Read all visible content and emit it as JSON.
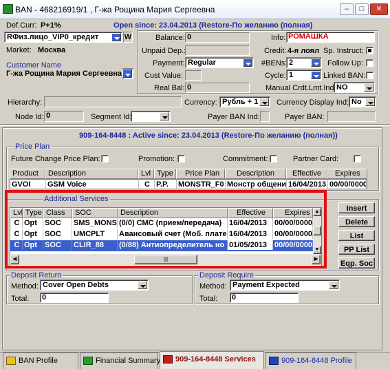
{
  "window": {
    "title": "BAN - 468216919/1 , Г-жа Рощина Мария Сергеевна",
    "min": "–",
    "max": "□",
    "close": "✕"
  },
  "header": {
    "def_curr_label": "Def.Curr:",
    "def_curr_value": "Р+1%",
    "open_since": "Open since: 23.04.2013 (Restore-По желанию (полная)",
    "account_type": "RФиз.лицо_VIP0_кредит",
    "account_type_flag": "W",
    "market_label": "Market:",
    "market_value": "Москва",
    "customer_name_label": "Customer Name",
    "customer_name_value": "Г-жа Рощина Мария Сергеевна",
    "balance_label": "Balance:",
    "balance_value": "0",
    "unpaid_dep_label": "Unpaid Dep.:",
    "unpaid_dep_value": "",
    "payment_label": "Payment:",
    "payment_value": "Regular",
    "cust_value_label": "Cust Value:",
    "real_bal_label": "Real Bal:",
    "real_bal_value": "0",
    "info_label": "Info:",
    "info_value": "РОМАШКА",
    "credit_label": "Credit:",
    "credit_value": "4-я лоял",
    "sp_instruct_label": "Sp. Instruct:",
    "bens_label": "#BENs:",
    "bens_value": "2",
    "follow_up_label": "Follow Up:",
    "cycle_label": "Cycle:",
    "cycle_value": "1",
    "linked_ban_label": "Linked BAN:",
    "manual_crdt_label": "Manual Crdt.Lmt.Ind:",
    "manual_crdt_value": "NO",
    "hierarchy_label": "Hierarchy:",
    "currency_label": "Currency:",
    "currency_value": "Рубль + 1",
    "currency_display_label": "Currency Display Ind:",
    "currency_display_value": "No",
    "node_id_label": "Node Id:",
    "node_id_value": "0",
    "segment_id_label": "Segment Id:",
    "payer_ban_ind_label": "Payer BAN Ind:",
    "payer_ban_label": "Payer BAN:"
  },
  "subscriber": {
    "title": "909-164-8448 : Active since: 23.04.2013 (Restore-По желанию (полная))"
  },
  "price_plan": {
    "group_title": "Price Plan",
    "future_change_label": "Future Change Price Plan:",
    "promotion_label": "Promotion:",
    "commitment_label": "Commitment:",
    "partner_card_label": "Partner Card:",
    "columns": [
      "Product",
      "Description",
      "Lvl",
      "Type",
      "Price Plan",
      "Description",
      "Effective",
      "Expires"
    ],
    "row": [
      "GVOI",
      "GSM Voice",
      "C",
      "P.P.",
      "MONSTR_F0",
      "Монстр общени",
      "16/04/2013",
      "00/00/0000"
    ]
  },
  "additional_services": {
    "group_title": "Additional Services",
    "columns": [
      "Lvl",
      "Type",
      "Class",
      "SOC",
      "Description",
      "Effective",
      "Expires"
    ],
    "rows": [
      [
        "C",
        "Opt",
        "SOC",
        "SMS_MONS",
        "(0/0) СМС (прием/передача)",
        "16/04/2013",
        "00/00/0000"
      ],
      [
        "C",
        "Opt",
        "SOC",
        "UMCPLT",
        "Авансовый счет (Моб. плате",
        "16/04/2013",
        "00/00/0000"
      ],
      [
        "C",
        "Opt",
        "SOC",
        "CLIR_88",
        "(0/88) Антиопределитель но",
        "01/05/2013",
        "00/00/0000"
      ]
    ],
    "buttons": [
      "Insert",
      "Delete",
      "List",
      "PP List",
      "Eqp. Soc"
    ]
  },
  "deposit_return": {
    "group_title": "Deposit Return",
    "method_label": "Method:",
    "method_value": "Cover Open Debts",
    "total_label": "Total:",
    "total_value": "0"
  },
  "deposit_require": {
    "group_title": "Deposit Require",
    "method_label": "Method:",
    "method_value": "Payment Expected",
    "total_label": "Total:",
    "total_value": "0"
  },
  "tabs": [
    "BAN Profile",
    "Financial Summary",
    "909-164-8448 Services",
    "909-164-8448 Profile"
  ],
  "colors": {
    "highlight_row": "#3a5fcd",
    "red_frame": "#e01010",
    "title_blue": "#1a2a9c",
    "info_red": "#cc0000"
  }
}
